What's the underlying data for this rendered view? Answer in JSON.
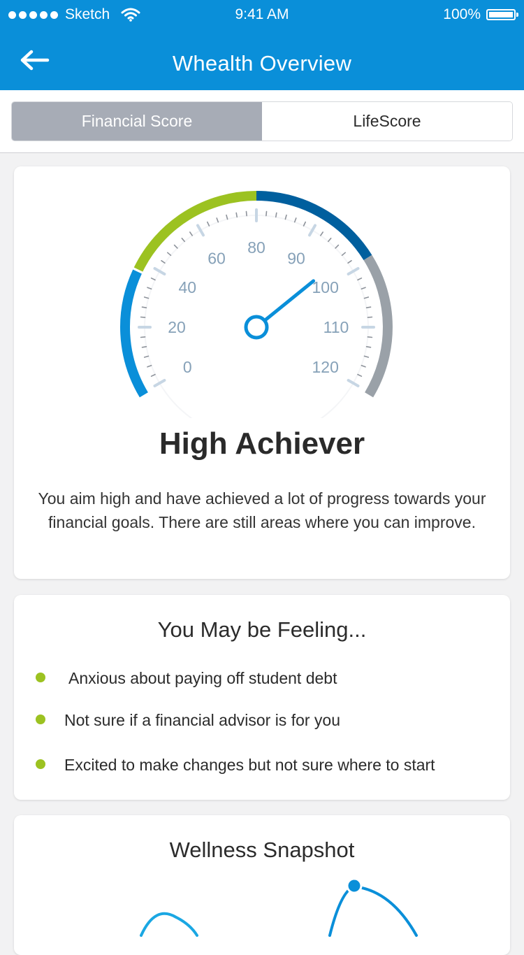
{
  "status_bar": {
    "carrier": "Sketch",
    "time": "9:41 AM",
    "battery": "100%"
  },
  "nav": {
    "title": "Whealth Overview",
    "back_icon": "arrow-left-icon"
  },
  "tabs": [
    {
      "label": "Financial Score",
      "active": true
    },
    {
      "label": "LifeScore",
      "active": false
    }
  ],
  "score_card": {
    "gauge": {
      "tick_labels": [
        "0",
        "20",
        "40",
        "60",
        "80",
        "90",
        "100",
        "110",
        "120"
      ],
      "needle_value": 97,
      "segment_colors": [
        "#0a8fd9",
        "#9cc221",
        "#005f9e",
        "#9aa1a8"
      ]
    },
    "title": "High Achiever",
    "description": "You aim high and have achieved a lot of progress towards your financial goals. There are still areas where you can improve."
  },
  "feeling_card": {
    "title": "You May be Feeling...",
    "items": [
      "Anxious about paying off student debt",
      "Not sure if a financial advisor is for you",
      "Excited to make changes but not sure where to start"
    ]
  },
  "snapshot_card": {
    "title": "Wellness Snapshot"
  }
}
